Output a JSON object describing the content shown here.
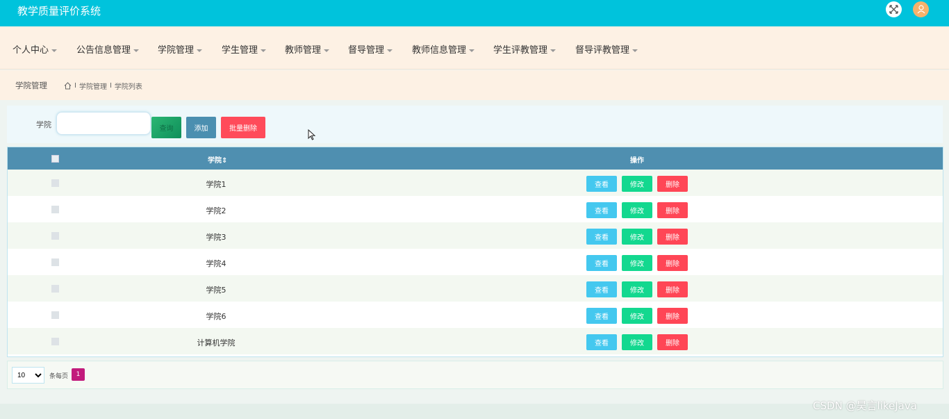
{
  "app": {
    "title": "教学质量评价系统"
  },
  "colors": {
    "topbar": "#00c3dc",
    "nav_bg": "#fdf1e4",
    "table_header": "#4f8fb0",
    "view": "#44c8ef",
    "edit": "#13d88f",
    "delete": "#ff4656",
    "active_page": "#c21b7c"
  },
  "header_icons": [
    "fullscreen-icon",
    "user-icon"
  ],
  "nav": {
    "items": [
      {
        "label": "个人中心"
      },
      {
        "label": "公告信息管理"
      },
      {
        "label": "学院管理"
      },
      {
        "label": "学生管理"
      },
      {
        "label": "教师管理"
      },
      {
        "label": "督导管理"
      },
      {
        "label": "教师信息管理"
      },
      {
        "label": "学生评教管理"
      },
      {
        "label": "督导评教管理"
      }
    ]
  },
  "breadcrumb": {
    "title": "学院管理",
    "path": [
      "学院管理",
      "学院列表"
    ],
    "separator": "I"
  },
  "search": {
    "label": "学院",
    "value": "",
    "placeholder": "",
    "search_button": "查询",
    "add_button": "添加",
    "batch_delete_button": "批量删除"
  },
  "table": {
    "columns": {
      "name": "学院",
      "sort_icon": "⇕",
      "actions": "操作"
    },
    "rows": [
      {
        "name": "学院1"
      },
      {
        "name": "学院2"
      },
      {
        "name": "学院3"
      },
      {
        "name": "学院4"
      },
      {
        "name": "学院5"
      },
      {
        "name": "学院6"
      },
      {
        "name": "计算机学院"
      }
    ],
    "row_actions": {
      "view": "查看",
      "edit": "修改",
      "delete": "删除"
    }
  },
  "pagination": {
    "page_size": "10",
    "page_size_label": "条每页",
    "current_page": "1"
  },
  "watermark": "CSDN @昊言likeJava"
}
